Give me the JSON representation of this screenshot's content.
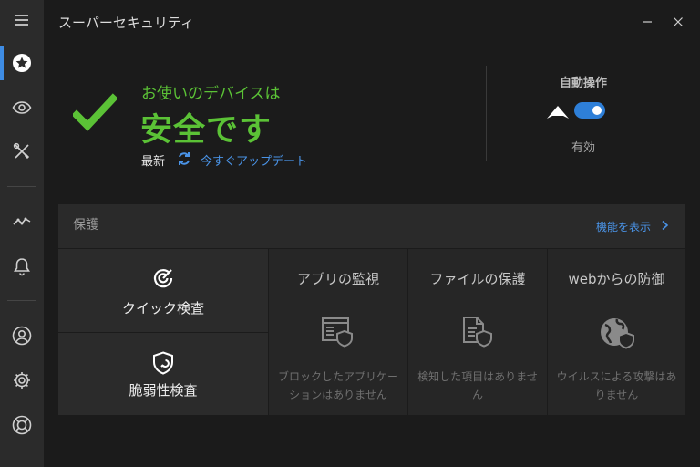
{
  "app": {
    "title": "スーパーセキュリティ"
  },
  "status": {
    "subtitle": "お使いのデバイスは",
    "main": "安全です",
    "update_state": "最新",
    "update_link": "今すぐアップデート"
  },
  "auto_mode": {
    "title": "自動操作",
    "enabled": true,
    "status": "有効"
  },
  "protection": {
    "title": "保護",
    "show_features": "機能を表示",
    "quick_scan": "クイック検査",
    "vulnerability_scan": "脆弱性検査",
    "tiles": [
      {
        "title": "アプリの監視",
        "desc": "ブロックしたアプリケーションはありません"
      },
      {
        "title": "ファイルの保護",
        "desc": "検知した項目はありません"
      },
      {
        "title": "webからの防御",
        "desc": "ウイルスによる攻撃はありません"
      }
    ]
  },
  "colors": {
    "accent": "#3e8ce4",
    "safe_green": "#5bc236",
    "link_blue": "#4a93e6"
  }
}
